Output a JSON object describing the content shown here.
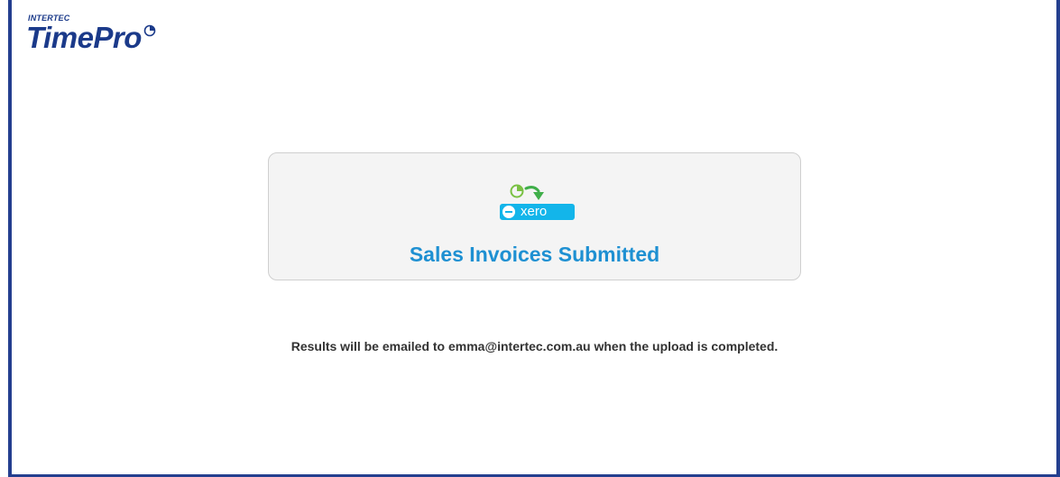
{
  "logo": {
    "brand_small": "INTERTEC",
    "brand_main": "TimePro",
    "icon": "clock-icon"
  },
  "card": {
    "title": "Sales Invoices Submitted",
    "icons": [
      "timepro-clock-icon",
      "arrow-icon",
      "xero-logo"
    ],
    "xero_label": "xero"
  },
  "message": {
    "text": "Results will be emailed to emma@intertec.com.au when the upload is completed."
  },
  "colors": {
    "border": "#243f8f",
    "brand": "#1b3a8a",
    "title": "#1e90d2",
    "xero": "#13b5ea",
    "clock_green": "#7ac143",
    "arrow_green": "#3fae49",
    "card_bg": "#f4f4f4"
  }
}
